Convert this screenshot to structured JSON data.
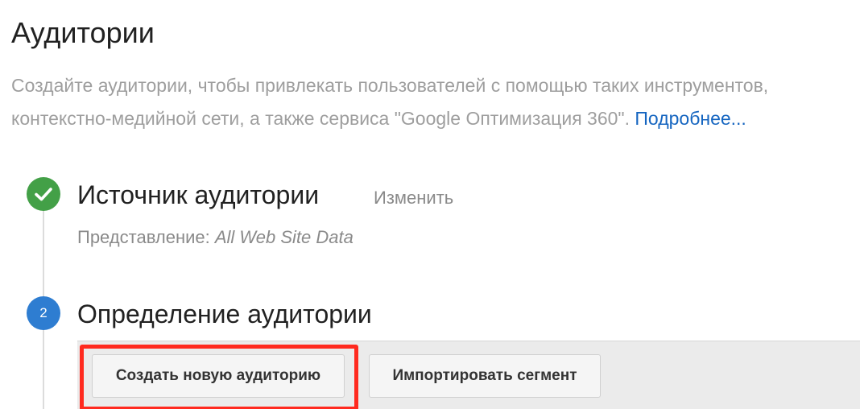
{
  "page": {
    "title": "Аудитории",
    "description_line1": "Создайте аудитории, чтобы привлекать пользователей с помощью таких инструментов,",
    "description_line2": "контекстно-медийной сети, а также сервиса \"Google Оптимизация 360\".",
    "learn_more": "Подробнее..."
  },
  "steps": [
    {
      "status": "completed",
      "icon": "checkmark-icon",
      "title": "Источник аудитории",
      "edit_label": "Изменить",
      "view_label": "Представление:",
      "view_value": "All Web Site Data"
    },
    {
      "status": "current",
      "number": "2",
      "title": "Определение аудитории"
    }
  ],
  "toolbar": {
    "create_label": "Создать новую аудиторию",
    "import_label": "Импортировать сегмент"
  },
  "colors": {
    "completed": "#43a047",
    "current": "#2e7dd1",
    "link": "#1565c0",
    "highlight": "#ff2a1f"
  }
}
